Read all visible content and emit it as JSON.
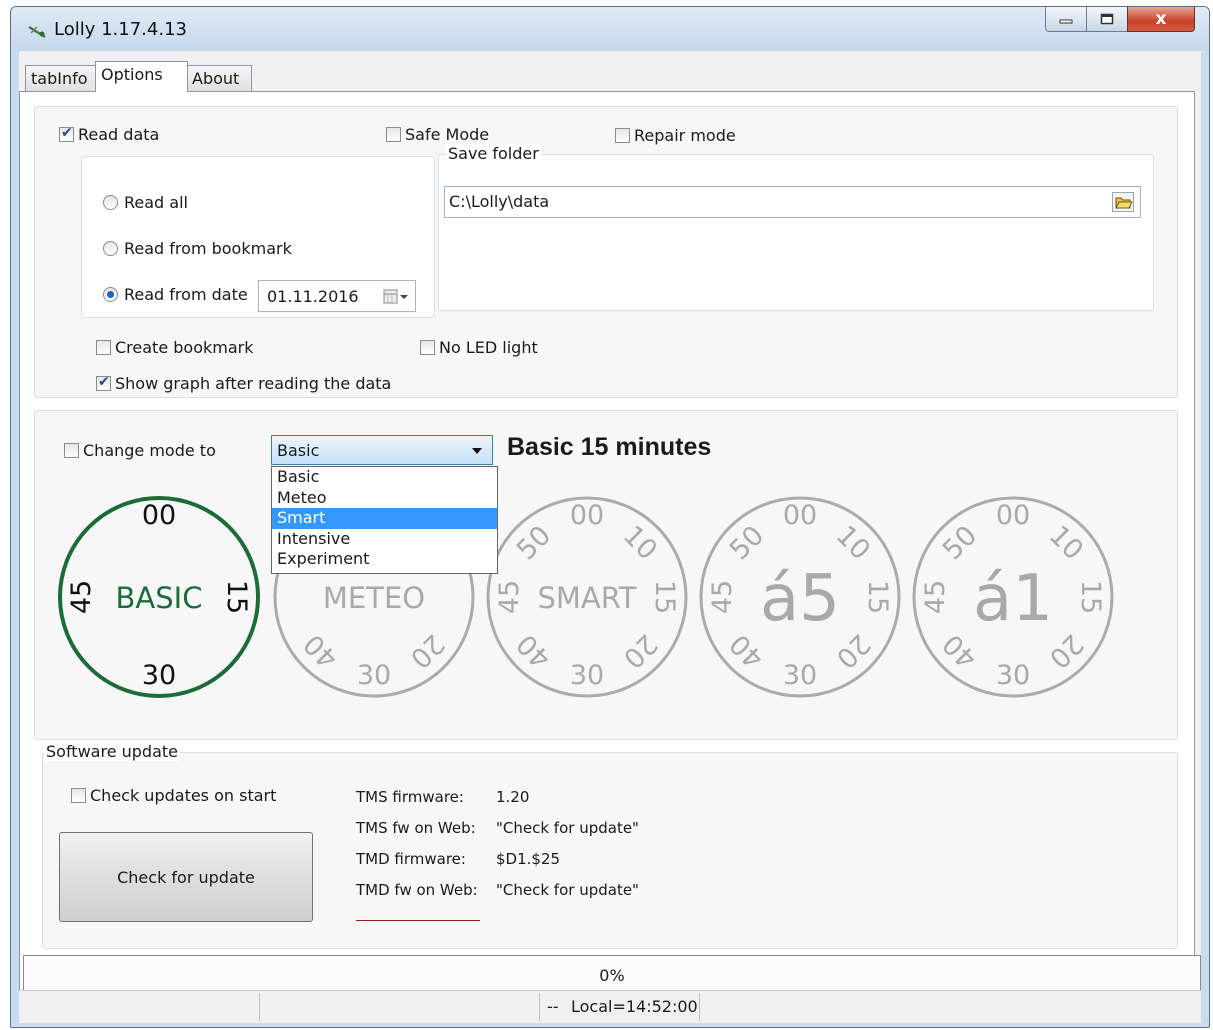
{
  "window": {
    "title": "Lolly 1.17.4.13",
    "close_glyph": "x"
  },
  "tabs": [
    {
      "label": "tabInfo"
    },
    {
      "label": "Options",
      "active": true
    },
    {
      "label": "About"
    }
  ],
  "options": {
    "read_data": {
      "label": "Read data",
      "checked": true
    },
    "safe_mode": {
      "label": "Safe Mode",
      "checked": false
    },
    "repair_mode": {
      "label": "Repair mode",
      "checked": false
    },
    "read_all": {
      "label": "Read all",
      "selected": false
    },
    "read_bookmark": {
      "label": "Read from bookmark",
      "selected": false
    },
    "read_date": {
      "label": "Read from date",
      "selected": true
    },
    "date_value": "01.11.2016",
    "save_folder": {
      "title": "Save folder",
      "path": "C:\\Lolly\\data"
    },
    "create_bookmark": {
      "label": "Create bookmark",
      "checked": false
    },
    "no_led": {
      "label": "No LED light",
      "checked": false
    },
    "show_graph": {
      "label": "Show graph after reading the data",
      "checked": true
    }
  },
  "mode": {
    "change_mode": {
      "label": "Change mode to",
      "checked": false
    },
    "selected": "Basic",
    "description": "Basic 15 minutes",
    "options": [
      "Basic",
      "Meteo",
      "Smart",
      "Intensive",
      "Experiment"
    ],
    "highlighted_option": "Smart",
    "dials": {
      "basic": {
        "top": "00",
        "left": "45",
        "right": "15",
        "bottom": "30",
        "center": "BASIC",
        "color": "#1e6b3a"
      },
      "meteo": {
        "bottom": "30",
        "center": "METEO",
        "lower_left": "40",
        "lower_right": "20",
        "color": "#a9a9a9"
      },
      "smart": {
        "top": "00",
        "upper_left": "50",
        "upper_right": "10",
        "left": "45",
        "right": "15",
        "lower_left": "40",
        "bottom": "30",
        "lower_right": "20",
        "center": "SMART"
      },
      "intensive": {
        "top": "00",
        "upper_left": "50",
        "upper_right": "10",
        "left": "45",
        "right": "15",
        "lower_left": "40",
        "bottom": "30",
        "lower_right": "20",
        "center": "á5"
      },
      "experiment": {
        "top": "00",
        "upper_left": "50",
        "upper_right": "10",
        "left": "45",
        "right": "15",
        "lower_left": "40",
        "bottom": "30",
        "lower_right": "20",
        "center": "á1"
      }
    }
  },
  "update": {
    "title": "Software update",
    "check_on_start": {
      "label": "Check updates on start",
      "checked": false
    },
    "check_button": "Check for update",
    "rows": [
      {
        "key": "TMS firmware:",
        "value": "1.20"
      },
      {
        "key": "TMS fw on Web:",
        "value": "\"Check for update\""
      },
      {
        "key": "TMD firmware:",
        "value": "$D1.$25"
      },
      {
        "key": "TMD fw on Web:",
        "value": "\"Check for update\""
      }
    ]
  },
  "progress": {
    "label": "0%",
    "value": 0
  },
  "status": {
    "sep": "--",
    "clock": "Local=14:52:00"
  },
  "icons": {
    "app": "lolly-app-icon",
    "folder": "folder-open-icon",
    "calendar": "calendar-icon"
  }
}
